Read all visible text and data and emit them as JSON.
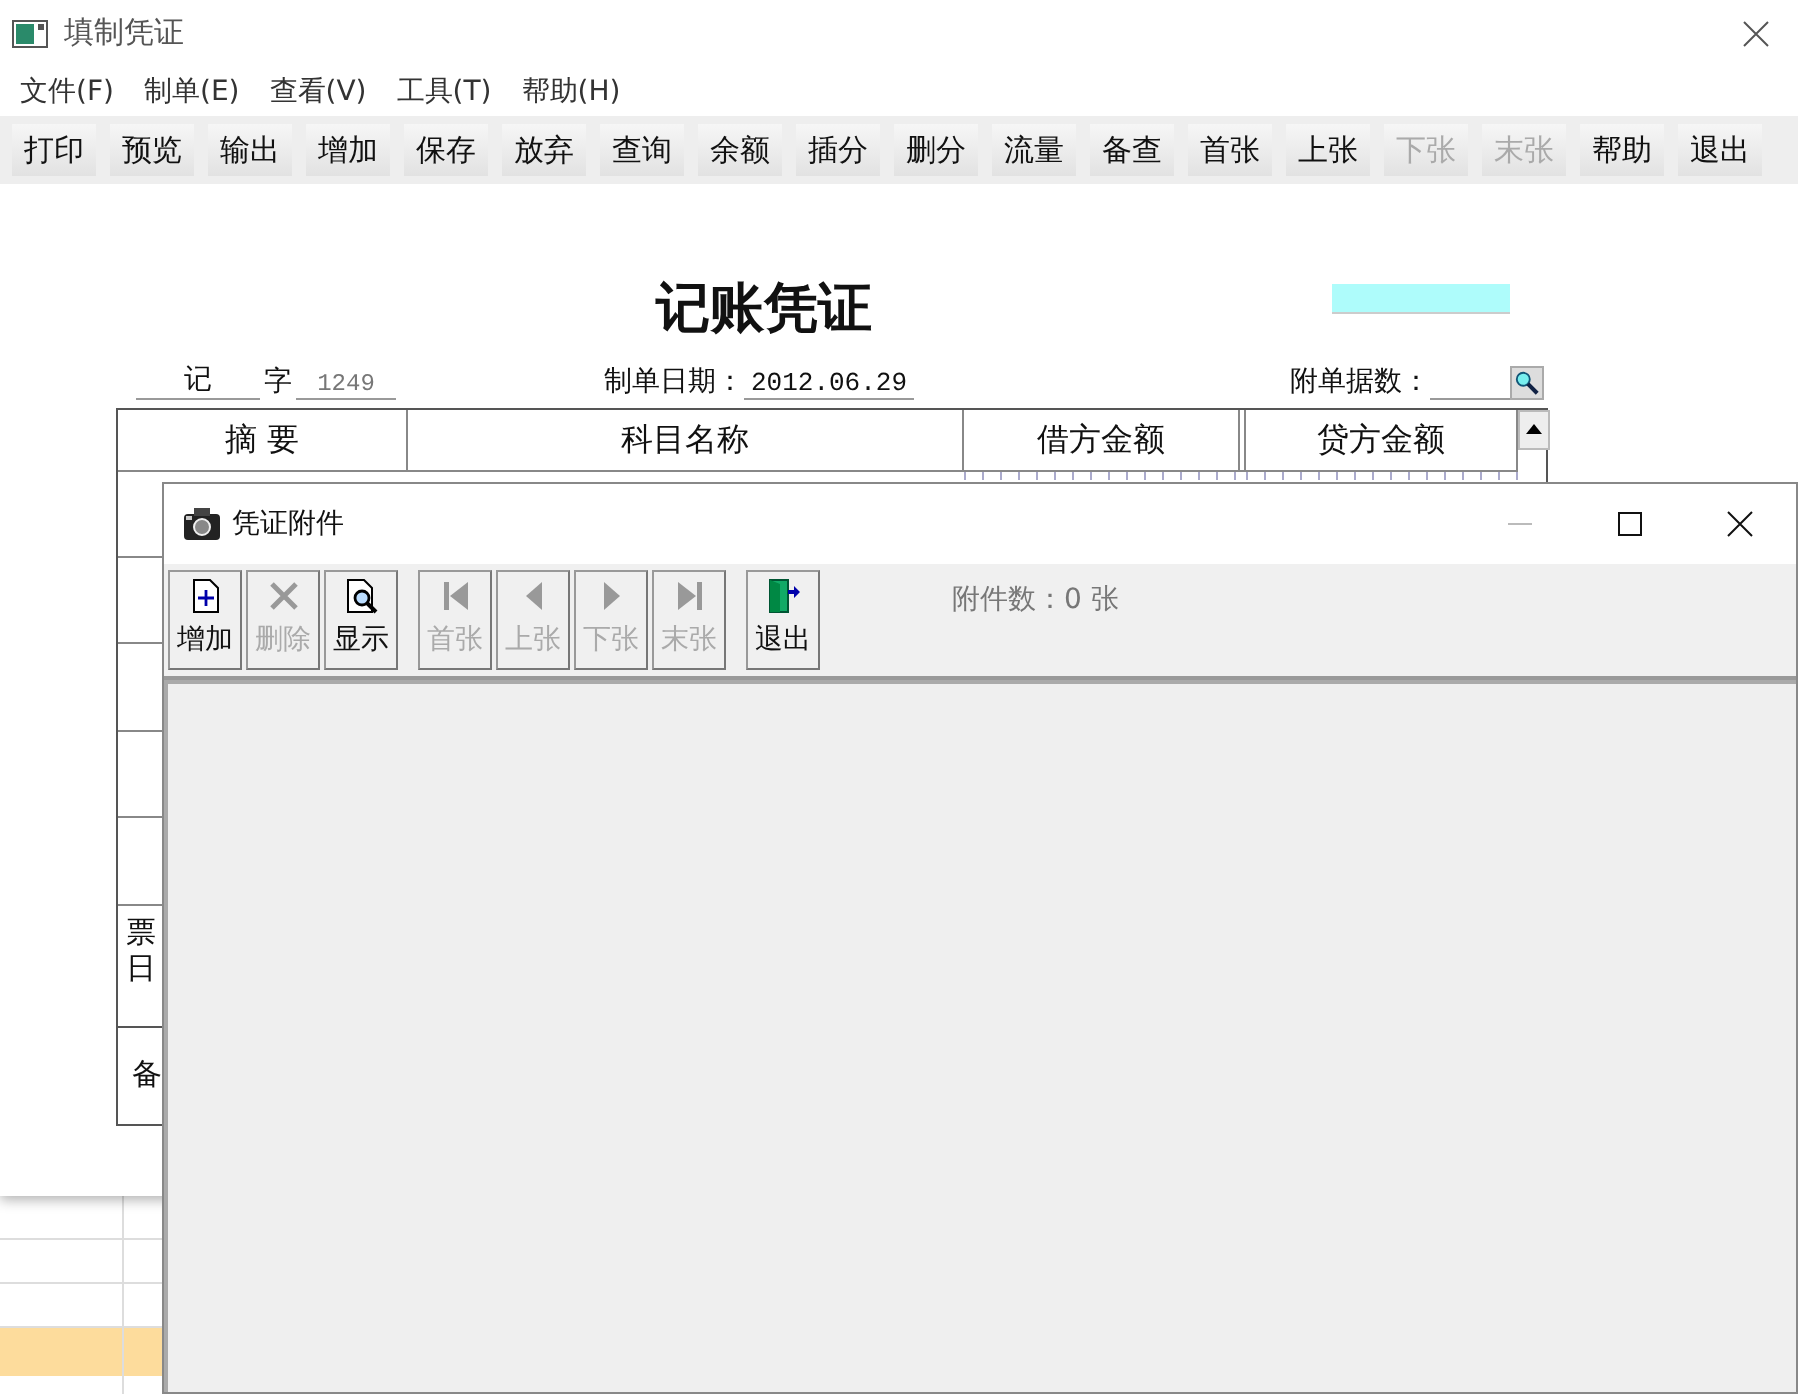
{
  "main_window": {
    "title": "填制凭证"
  },
  "menu": [
    {
      "label": "文件(F)"
    },
    {
      "label": "制单(E)"
    },
    {
      "label": "查看(V)"
    },
    {
      "label": "工具(T)"
    },
    {
      "label": "帮助(H)"
    }
  ],
  "toolbar": [
    {
      "label": "打印",
      "disabled": false
    },
    {
      "label": "预览",
      "disabled": false
    },
    {
      "label": "输出",
      "disabled": false
    },
    {
      "label": "增加",
      "disabled": false
    },
    {
      "label": "保存",
      "disabled": false
    },
    {
      "label": "放弃",
      "disabled": false
    },
    {
      "label": "查询",
      "disabled": false
    },
    {
      "label": "余额",
      "disabled": false
    },
    {
      "label": "插分",
      "disabled": false
    },
    {
      "label": "删分",
      "disabled": false
    },
    {
      "label": "流量",
      "disabled": false
    },
    {
      "label": "备查",
      "disabled": false
    },
    {
      "label": "首张",
      "disabled": false
    },
    {
      "label": "上张",
      "disabled": false
    },
    {
      "label": "下张",
      "disabled": true
    },
    {
      "label": "末张",
      "disabled": true
    },
    {
      "label": "帮助",
      "disabled": false
    },
    {
      "label": "退出",
      "disabled": false
    }
  ],
  "voucher": {
    "title": "记账凭证",
    "type_label": "记",
    "type_suffix": "字",
    "number": "1249",
    "date_label": "制单日期：",
    "date": "2012.06.29",
    "attachments_label": "附单据数：",
    "columns": [
      "摘 要",
      "科目名称",
      "借方金额",
      "贷方金额"
    ],
    "ticket_cell_lines": [
      "票",
      "日"
    ],
    "remark_cell": "备"
  },
  "dialog": {
    "title": "凭证附件",
    "tool_groups": [
      [
        {
          "label": "增加",
          "kind": "add",
          "disabled": false
        },
        {
          "label": "删除",
          "kind": "delete",
          "disabled": true
        },
        {
          "label": "显示",
          "kind": "view",
          "disabled": false
        }
      ],
      [
        {
          "label": "首张",
          "kind": "first",
          "disabled": true
        },
        {
          "label": "上张",
          "kind": "prev",
          "disabled": true
        },
        {
          "label": "下张",
          "kind": "next",
          "disabled": true
        },
        {
          "label": "末张",
          "kind": "last",
          "disabled": true
        }
      ],
      [
        {
          "label": "退出",
          "kind": "exit",
          "disabled": false
        }
      ]
    ],
    "count_text": "附件数：0 张"
  }
}
